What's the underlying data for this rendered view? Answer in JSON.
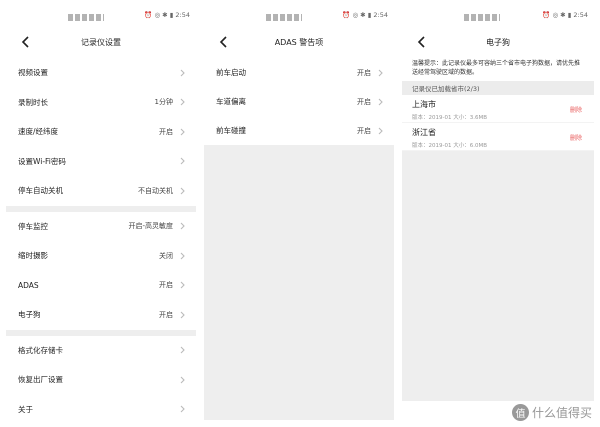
{
  "status": {
    "right": "⏰ ◎ ✱ ▮ 2:54"
  },
  "panel1": {
    "title": "记录仪设置",
    "groups": [
      [
        {
          "label": "视频设置",
          "value": ""
        },
        {
          "label": "录制时长",
          "value": "1分钟"
        },
        {
          "label": "速度/经纬度",
          "value": "开启"
        },
        {
          "label": "设置Wi-Fi密码",
          "value": ""
        },
        {
          "label": "停车自动关机",
          "value": "不自动关机"
        }
      ],
      [
        {
          "label": "停车监控",
          "value": "开启-高灵敏度"
        },
        {
          "label": "缩时摄影",
          "value": "关闭"
        },
        {
          "label": "ADAS",
          "value": "开启"
        },
        {
          "label": "电子狗",
          "value": "开启"
        }
      ],
      [
        {
          "label": "格式化存储卡",
          "value": ""
        },
        {
          "label": "恢复出厂设置",
          "value": ""
        },
        {
          "label": "关于",
          "value": ""
        }
      ]
    ]
  },
  "panel2": {
    "title": "ADAS 警告项",
    "items": [
      {
        "label": "前车启动",
        "value": "开启"
      },
      {
        "label": "车道偏离",
        "value": "开启"
      },
      {
        "label": "前车碰撞",
        "value": "开启"
      }
    ]
  },
  "panel3": {
    "title": "电子狗",
    "tip": "温馨提示：此记录仪最多可容纳三个省市电子狗数据，请优先推送经常驾驶区域的数据。",
    "section_header": "记录仪已加载省市(2/3)",
    "provinces": [
      {
        "name": "上海市",
        "meta": "版本：2019-01 大小：3.6MB",
        "action": "删除"
      },
      {
        "name": "浙江省",
        "meta": "版本：2019-01 大小：6.0MB",
        "action": "删除"
      }
    ]
  },
  "watermark": {
    "badge": "值",
    "text": "什么值得买"
  }
}
